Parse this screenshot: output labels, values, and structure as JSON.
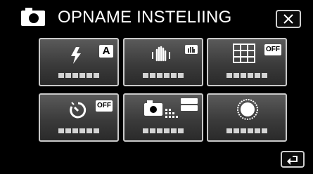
{
  "header": {
    "title": "OPNAME INSTELIING",
    "camera_icon": "camera-icon",
    "close_icon": "close-icon"
  },
  "menu": {
    "tiles": [
      {
        "name": "flash",
        "icon": "flash-icon",
        "badge": "A",
        "value": ""
      },
      {
        "name": "image-stabilizer",
        "icon": "stabilizer-hand-icon",
        "badge": "",
        "value": ""
      },
      {
        "name": "grid",
        "icon": "grid-icon",
        "badge": "OFF",
        "value": ""
      },
      {
        "name": "self-timer",
        "icon": "self-timer-icon",
        "badge": "OFF",
        "value": ""
      },
      {
        "name": "image-size",
        "icon": "image-size-camera-icon",
        "badge": "",
        "value": ""
      },
      {
        "name": "shutter-mode",
        "icon": "shutter-mode-icon",
        "badge": "",
        "value": ""
      }
    ]
  },
  "footer": {
    "back_icon": "back-arrow-icon"
  },
  "colors": {
    "background": "#000000",
    "tile_border": "#c9c9c9",
    "tile_gradient_top": "#5a5a5a",
    "tile_gradient_bottom": "#2a2a2a"
  }
}
